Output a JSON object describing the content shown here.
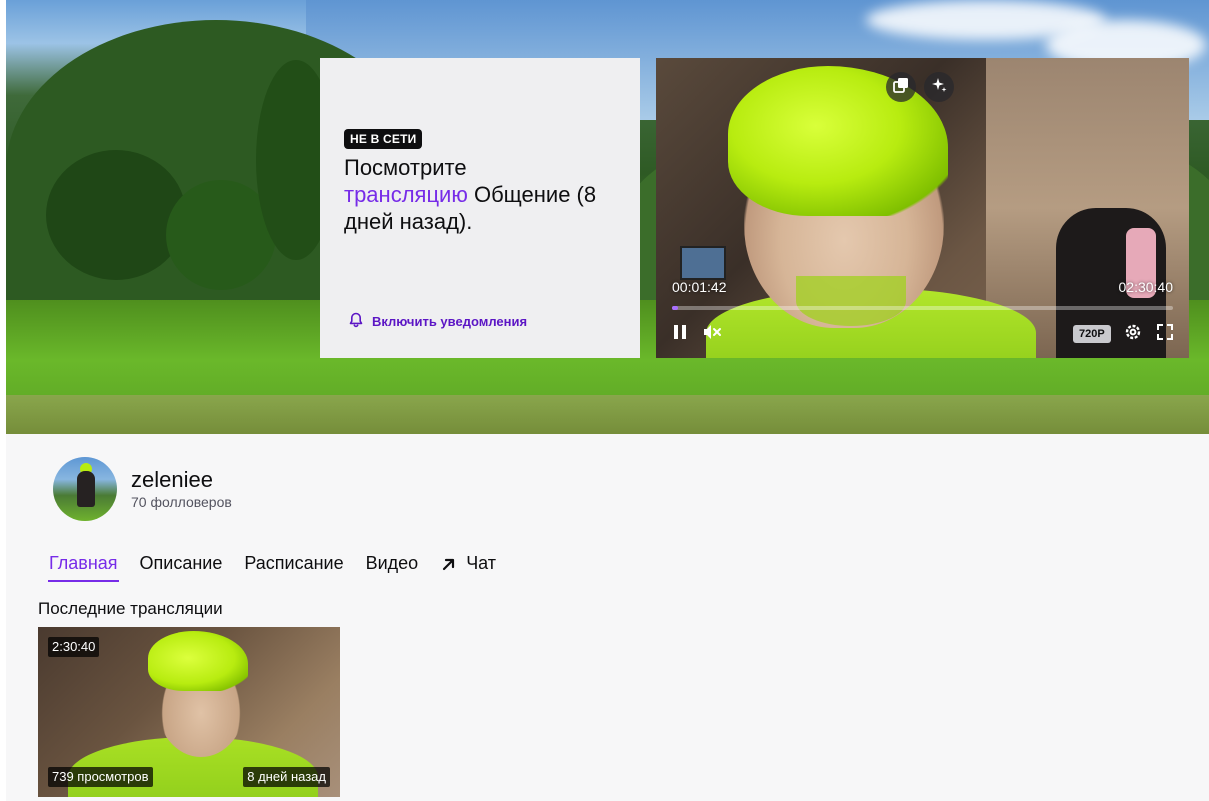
{
  "banner": {
    "offline_badge": "НЕ В СЕТИ",
    "offline_text_before": "Посмотрите",
    "offline_link": "трансляцию",
    "offline_text_after": "Общение (8 дней назад).",
    "notify_label": "Включить уведомления",
    "icons": {
      "notify": "bell-icon"
    }
  },
  "player": {
    "current_time": "00:01:42",
    "duration": "02:30:40",
    "progress_fraction": 0.0113,
    "quality": "720P",
    "icons": {
      "popout": "popout-icon",
      "clip": "sparkle-icon",
      "pause": "pause-icon",
      "mute": "volume-muted-icon",
      "settings": "gear-icon",
      "fullscreen": "fullscreen-icon"
    }
  },
  "channel": {
    "name": "zeleniee",
    "followers": "70 фолловеров"
  },
  "tabs": [
    {
      "label": "Главная",
      "active": true
    },
    {
      "label": "Описание",
      "active": false
    },
    {
      "label": "Расписание",
      "active": false
    },
    {
      "label": "Видео",
      "active": false
    },
    {
      "label": "Чат",
      "active": false,
      "icon": "arrow-up-right-icon"
    }
  ],
  "recent": {
    "title": "Последние трансляции",
    "items": [
      {
        "duration": "2:30:40",
        "views": "739 просмотров",
        "age": "8 дней назад"
      }
    ]
  },
  "colors": {
    "accent": "#772ce8",
    "accent_dark": "#5c16c5",
    "progress": "#a970ff",
    "page_bg": "#f7f7f8",
    "card_bg": "#efeff1"
  }
}
